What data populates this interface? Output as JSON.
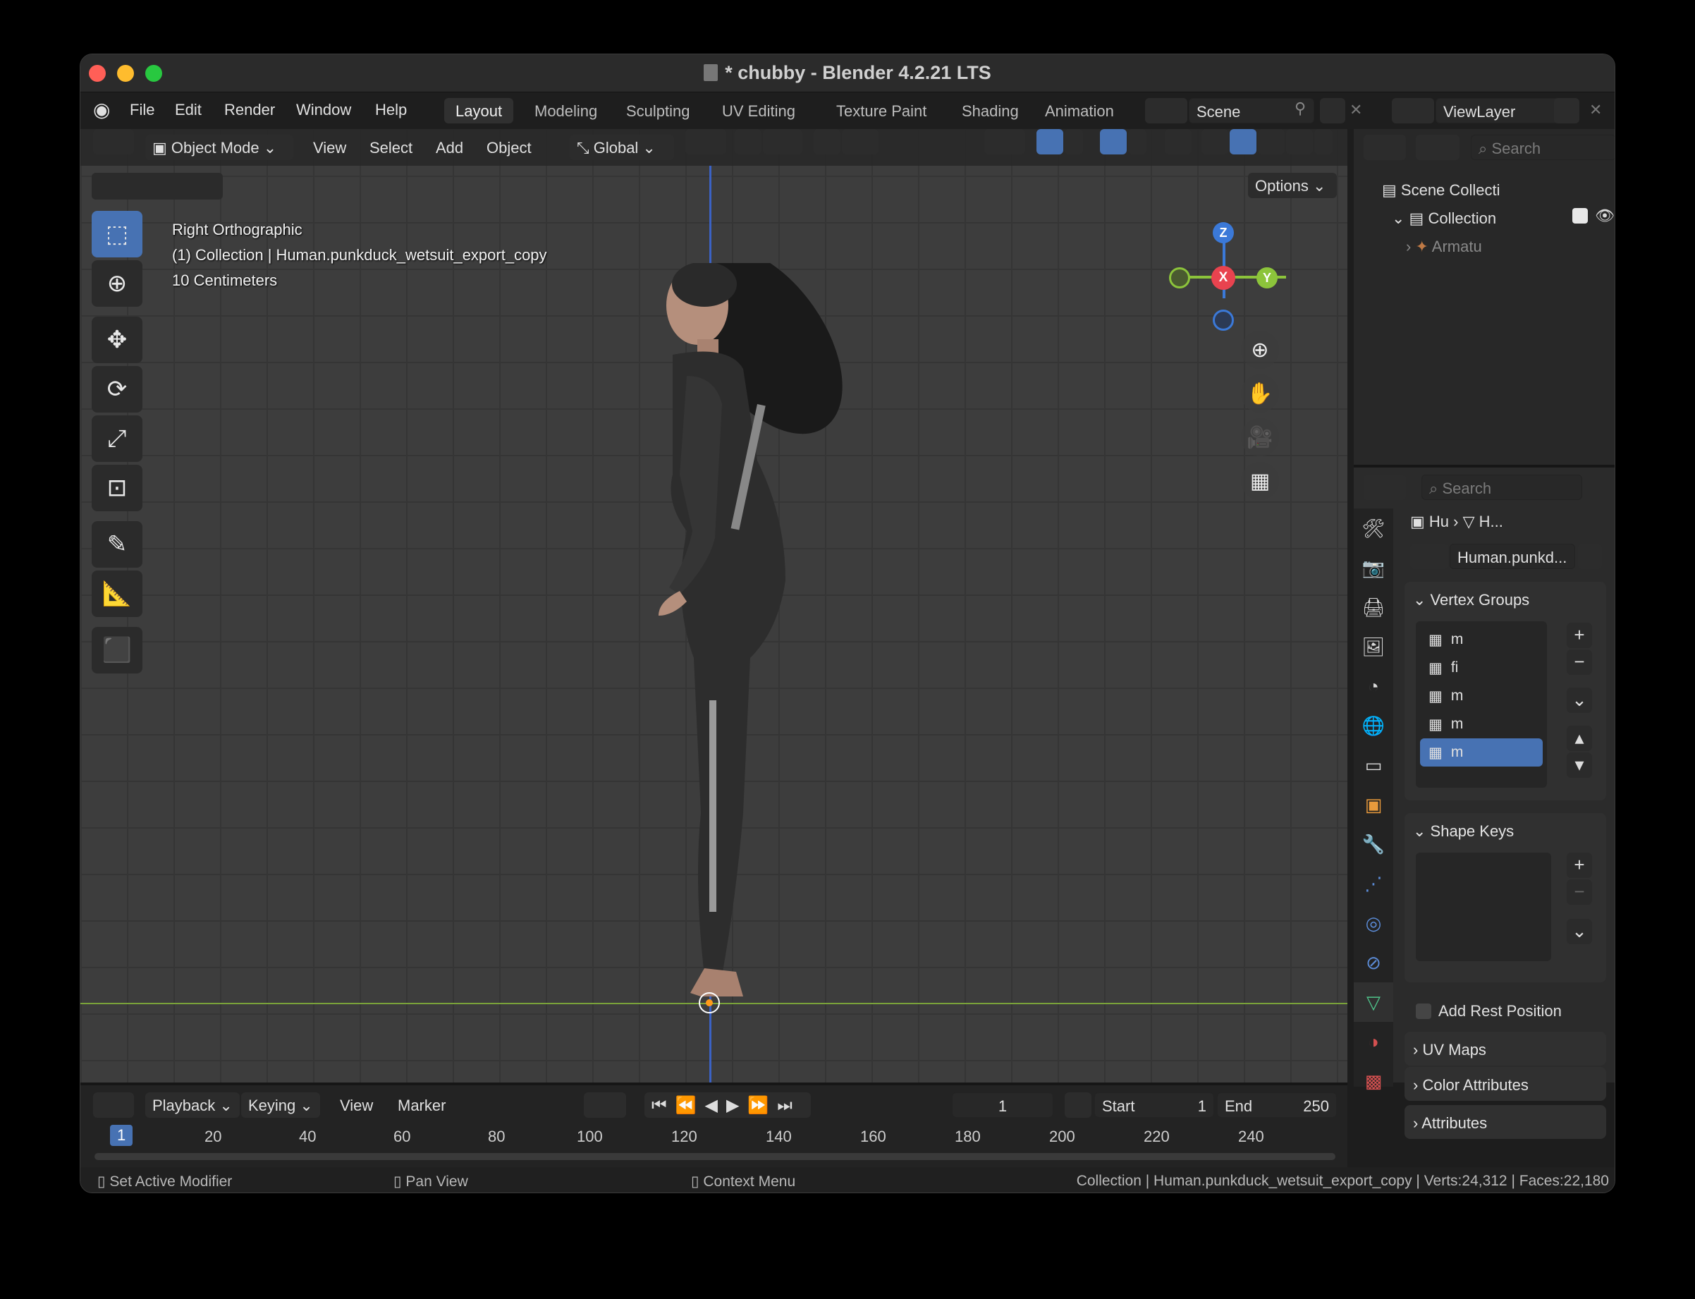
{
  "window": {
    "title": "* chubby - Blender 4.2.21 LTS"
  },
  "menu": [
    "File",
    "Edit",
    "Render",
    "Window",
    "Help"
  ],
  "workspaces": [
    "Layout",
    "Modeling",
    "Sculpting",
    "UV Editing",
    "Texture Paint",
    "Shading",
    "Animation"
  ],
  "scene": {
    "name": "Scene",
    "view_layer": "ViewLayer"
  },
  "viewport_header": {
    "mode": "Object Mode",
    "view": "View",
    "select": "Select",
    "add": "Add",
    "object": "Object",
    "orientation": "Global",
    "options": "Options"
  },
  "overlay": {
    "view_name": "Right Orthographic",
    "collection_line": "(1) Collection | Human.punkduck_wetsuit_export_copy",
    "scale": "10 Centimeters"
  },
  "gizmo": {
    "z": "Z",
    "x": "X",
    "y": "Y"
  },
  "outliner": {
    "search_placeholder": "Search",
    "scene_collection": "Scene Collecti",
    "collection": "Collection",
    "armature": "Armatu"
  },
  "properties": {
    "search_placeholder": "Search",
    "breadcrumb_obj": "Hu",
    "breadcrumb_mesh": "H...",
    "mesh_name": "Human.punkd...",
    "vertex_groups_title": "Vertex Groups",
    "vertex_groups": [
      "m",
      "fi",
      "m",
      "m",
      "m"
    ],
    "shape_keys_title": "Shape Keys",
    "add_rest_position": "Add Rest Position",
    "uv_maps": "UV Maps",
    "color_attributes": "Color Attributes",
    "attributes": "Attributes"
  },
  "timeline": {
    "playback": "Playback",
    "keying": "Keying",
    "view": "View",
    "marker": "Marker",
    "current_frame": "1",
    "start_label": "Start",
    "start": "1",
    "end_label": "End",
    "end": "250",
    "ticks": [
      "1",
      "20",
      "40",
      "60",
      "80",
      "100",
      "120",
      "140",
      "160",
      "180",
      "200",
      "220",
      "240"
    ]
  },
  "status": {
    "left1": "Set Active Modifier",
    "left2": "Pan View",
    "left3": "Context Menu",
    "right": "Collection | Human.punkduck_wetsuit_export_copy | Verts:24,312 | Faces:22,180"
  },
  "colors": {
    "accent": "#4772b3",
    "x_axis": "#e8434f",
    "y_axis": "#8cc43b",
    "z_axis": "#3b79d8"
  }
}
